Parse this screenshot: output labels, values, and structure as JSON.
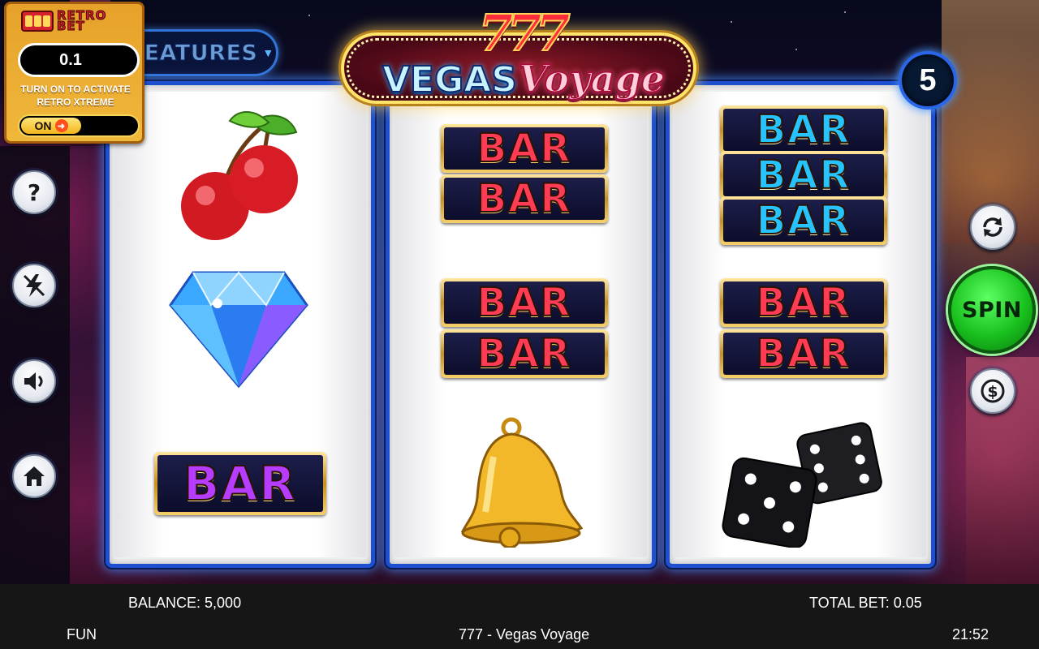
{
  "logo": {
    "numbers": "777",
    "word1": "VEGAS",
    "word2": "Voyage"
  },
  "retro_bet": {
    "brand_line1": "RETRO",
    "brand_line2": "BET",
    "value": "0.1",
    "caption_line1": "TURN ON TO ACTIVATE",
    "caption_line2": "RETRO XTREME",
    "toggle_label": "ON"
  },
  "features_button": {
    "label": "FEATURES"
  },
  "lines_badge": "5",
  "spin_button": {
    "label": "SPIN"
  },
  "side_buttons_left": [
    "help-icon",
    "lightning-icon",
    "speaker-icon",
    "home-icon"
  ],
  "side_buttons_right": [
    "autoplay-refresh-icon",
    "bet-coin-icon"
  ],
  "reels": [
    {
      "symbols": [
        "cherries",
        "diamond",
        "BAR"
      ]
    },
    {
      "symbols": [
        "BAR",
        "BAR",
        "BAR",
        "BAR",
        "bell"
      ]
    },
    {
      "symbols": [
        "BAR",
        "BAR",
        "BAR",
        "BAR",
        "BAR",
        "dice"
      ]
    }
  ],
  "footer": {
    "balance": "BALANCE: 5,000",
    "total_bet": "TOTAL BET: 0.05",
    "mode": "FUN",
    "game_title": "777 - Vegas Voyage",
    "clock": "21:52"
  },
  "colors": {
    "reel_border": "#1d4fd0",
    "spin_green": "#19c11e",
    "retro_panel": "#e6a12a",
    "footer_bg": "#161616"
  }
}
